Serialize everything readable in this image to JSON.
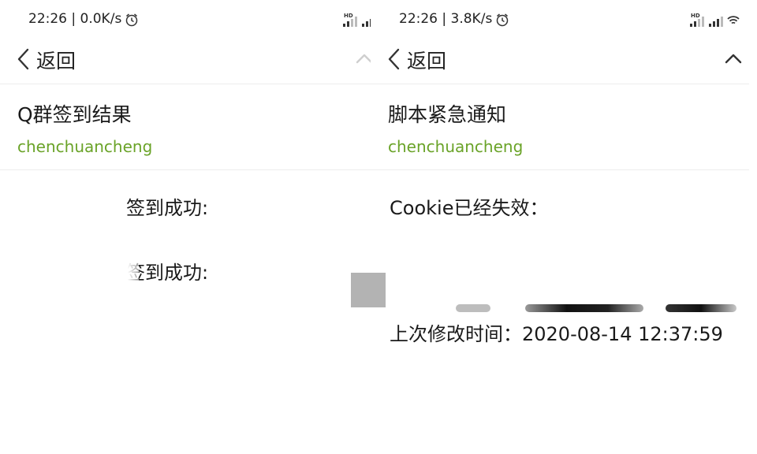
{
  "panels": [
    {
      "status": {
        "time_speed": "22:26 | 0.0K/s",
        "signal_icon": "signal-bars-icon",
        "alarm_icon": "alarm-clock-icon"
      },
      "nav": {
        "back_label": "返回",
        "collapse_icon": "chevron-up-icon"
      },
      "email": {
        "subject": "Q群签到结果",
        "sender": "chenchuancheng",
        "lines": [
          "签到成功:",
          "签到成功:"
        ]
      }
    },
    {
      "status": {
        "time_speed": "22:26 | 3.8K/s",
        "signal_icon": "signal-bars-icon",
        "alarm_icon": "alarm-clock-icon"
      },
      "nav": {
        "back_label": "返回",
        "collapse_icon": "chevron-up-icon"
      },
      "email": {
        "subject": "脚本紧急通知",
        "sender": "chenchuancheng",
        "lines": [
          "Cookie已经失效：",
          "上次修改时间：2020-08-14 12:37:59"
        ]
      }
    }
  ],
  "colors": {
    "sender": "#6aa328",
    "text": "#1a1a1a",
    "divider": "#ededed",
    "redaction": "#b3b3b3"
  }
}
